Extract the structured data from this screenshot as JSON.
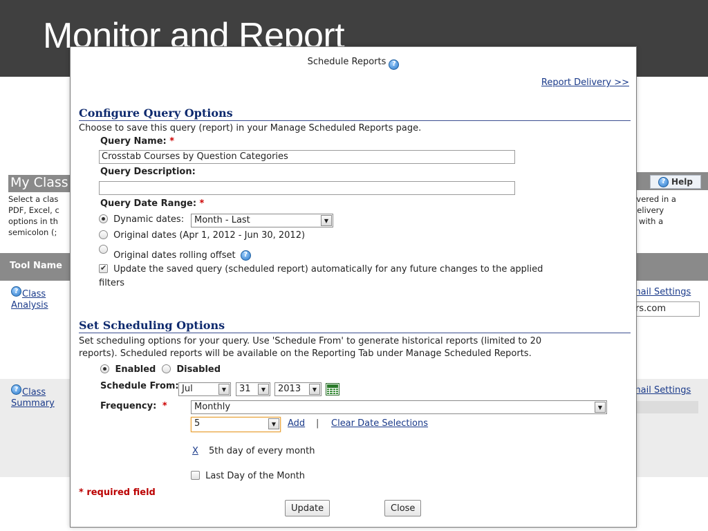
{
  "slide": {
    "title": "Monitor and Report"
  },
  "background": {
    "section_title": "My Class",
    "help_label": "Help",
    "desc_left": [
      "Select a clas",
      "PDF, Excel, c",
      "options in th",
      "semicolon (;"
    ],
    "desc_right": [
      "livered in a",
      "delivery",
      "il with a"
    ],
    "table_header": "Tool Name",
    "rows": [
      {
        "name_line1": "Class",
        "name_line2": "Analysis",
        "email_link": "mail Settings",
        "email_value": "rs.com"
      },
      {
        "name_line1": "Class",
        "name_line2": "Summary",
        "email_link": "mail Settings"
      }
    ]
  },
  "modal": {
    "title": "Schedule Reports",
    "report_delivery_link": "Report Delivery >>",
    "query_section": {
      "heading": "Configure Query Options",
      "description": "Choose to save this query (report) in your Manage Scheduled Reports page.",
      "name_label": "Query Name:",
      "name_value": "Crosstab Courses by Question Categories",
      "description_label": "Query Description:",
      "description_value": "",
      "date_range_label": "Query Date Range:",
      "required_mark": "*",
      "option_dynamic": "Dynamic dates:",
      "dynamic_select_value": "Month - Last",
      "option_original": "Original dates (Apr 1, 2012 - Jun 30, 2012)",
      "option_rolling": "Original dates rolling offset",
      "update_checkbox_line1": "Update the saved query (scheduled report) automatically for any future changes to the applied",
      "update_checkbox_line2": "filters",
      "update_checked": true,
      "selected_date_option": "dynamic"
    },
    "schedule_section": {
      "heading": "Set Scheduling Options",
      "description_line1": "Set scheduling options for your query. Use 'Schedule From' to generate historical reports (limited to 20",
      "description_line2": "reports). Scheduled reports will be available on the Reporting Tab under Manage Scheduled Reports.",
      "enabled_label": "Enabled",
      "disabled_label": "Disabled",
      "enabled_selected": true,
      "schedule_from_label": "Schedule From:",
      "month_value": "Jul",
      "day_value": "31",
      "year_value": "2013",
      "frequency_label": "Frequency:",
      "frequency_value": "Monthly",
      "day_select_value": "5",
      "add_link": "Add",
      "separator": "|",
      "clear_link": "Clear Date Selections",
      "remove_link": "X",
      "selected_date_text": "5th day of every month",
      "last_day_label": "Last Day of the Month",
      "last_day_checked": false
    },
    "required_note": "* required field",
    "update_button": "Update",
    "close_button": "Close"
  },
  "colors": {
    "header_bg": "#404040",
    "section_heading": "#0e2a6e",
    "link": "#1a3a8a",
    "required": "#cc0000"
  }
}
